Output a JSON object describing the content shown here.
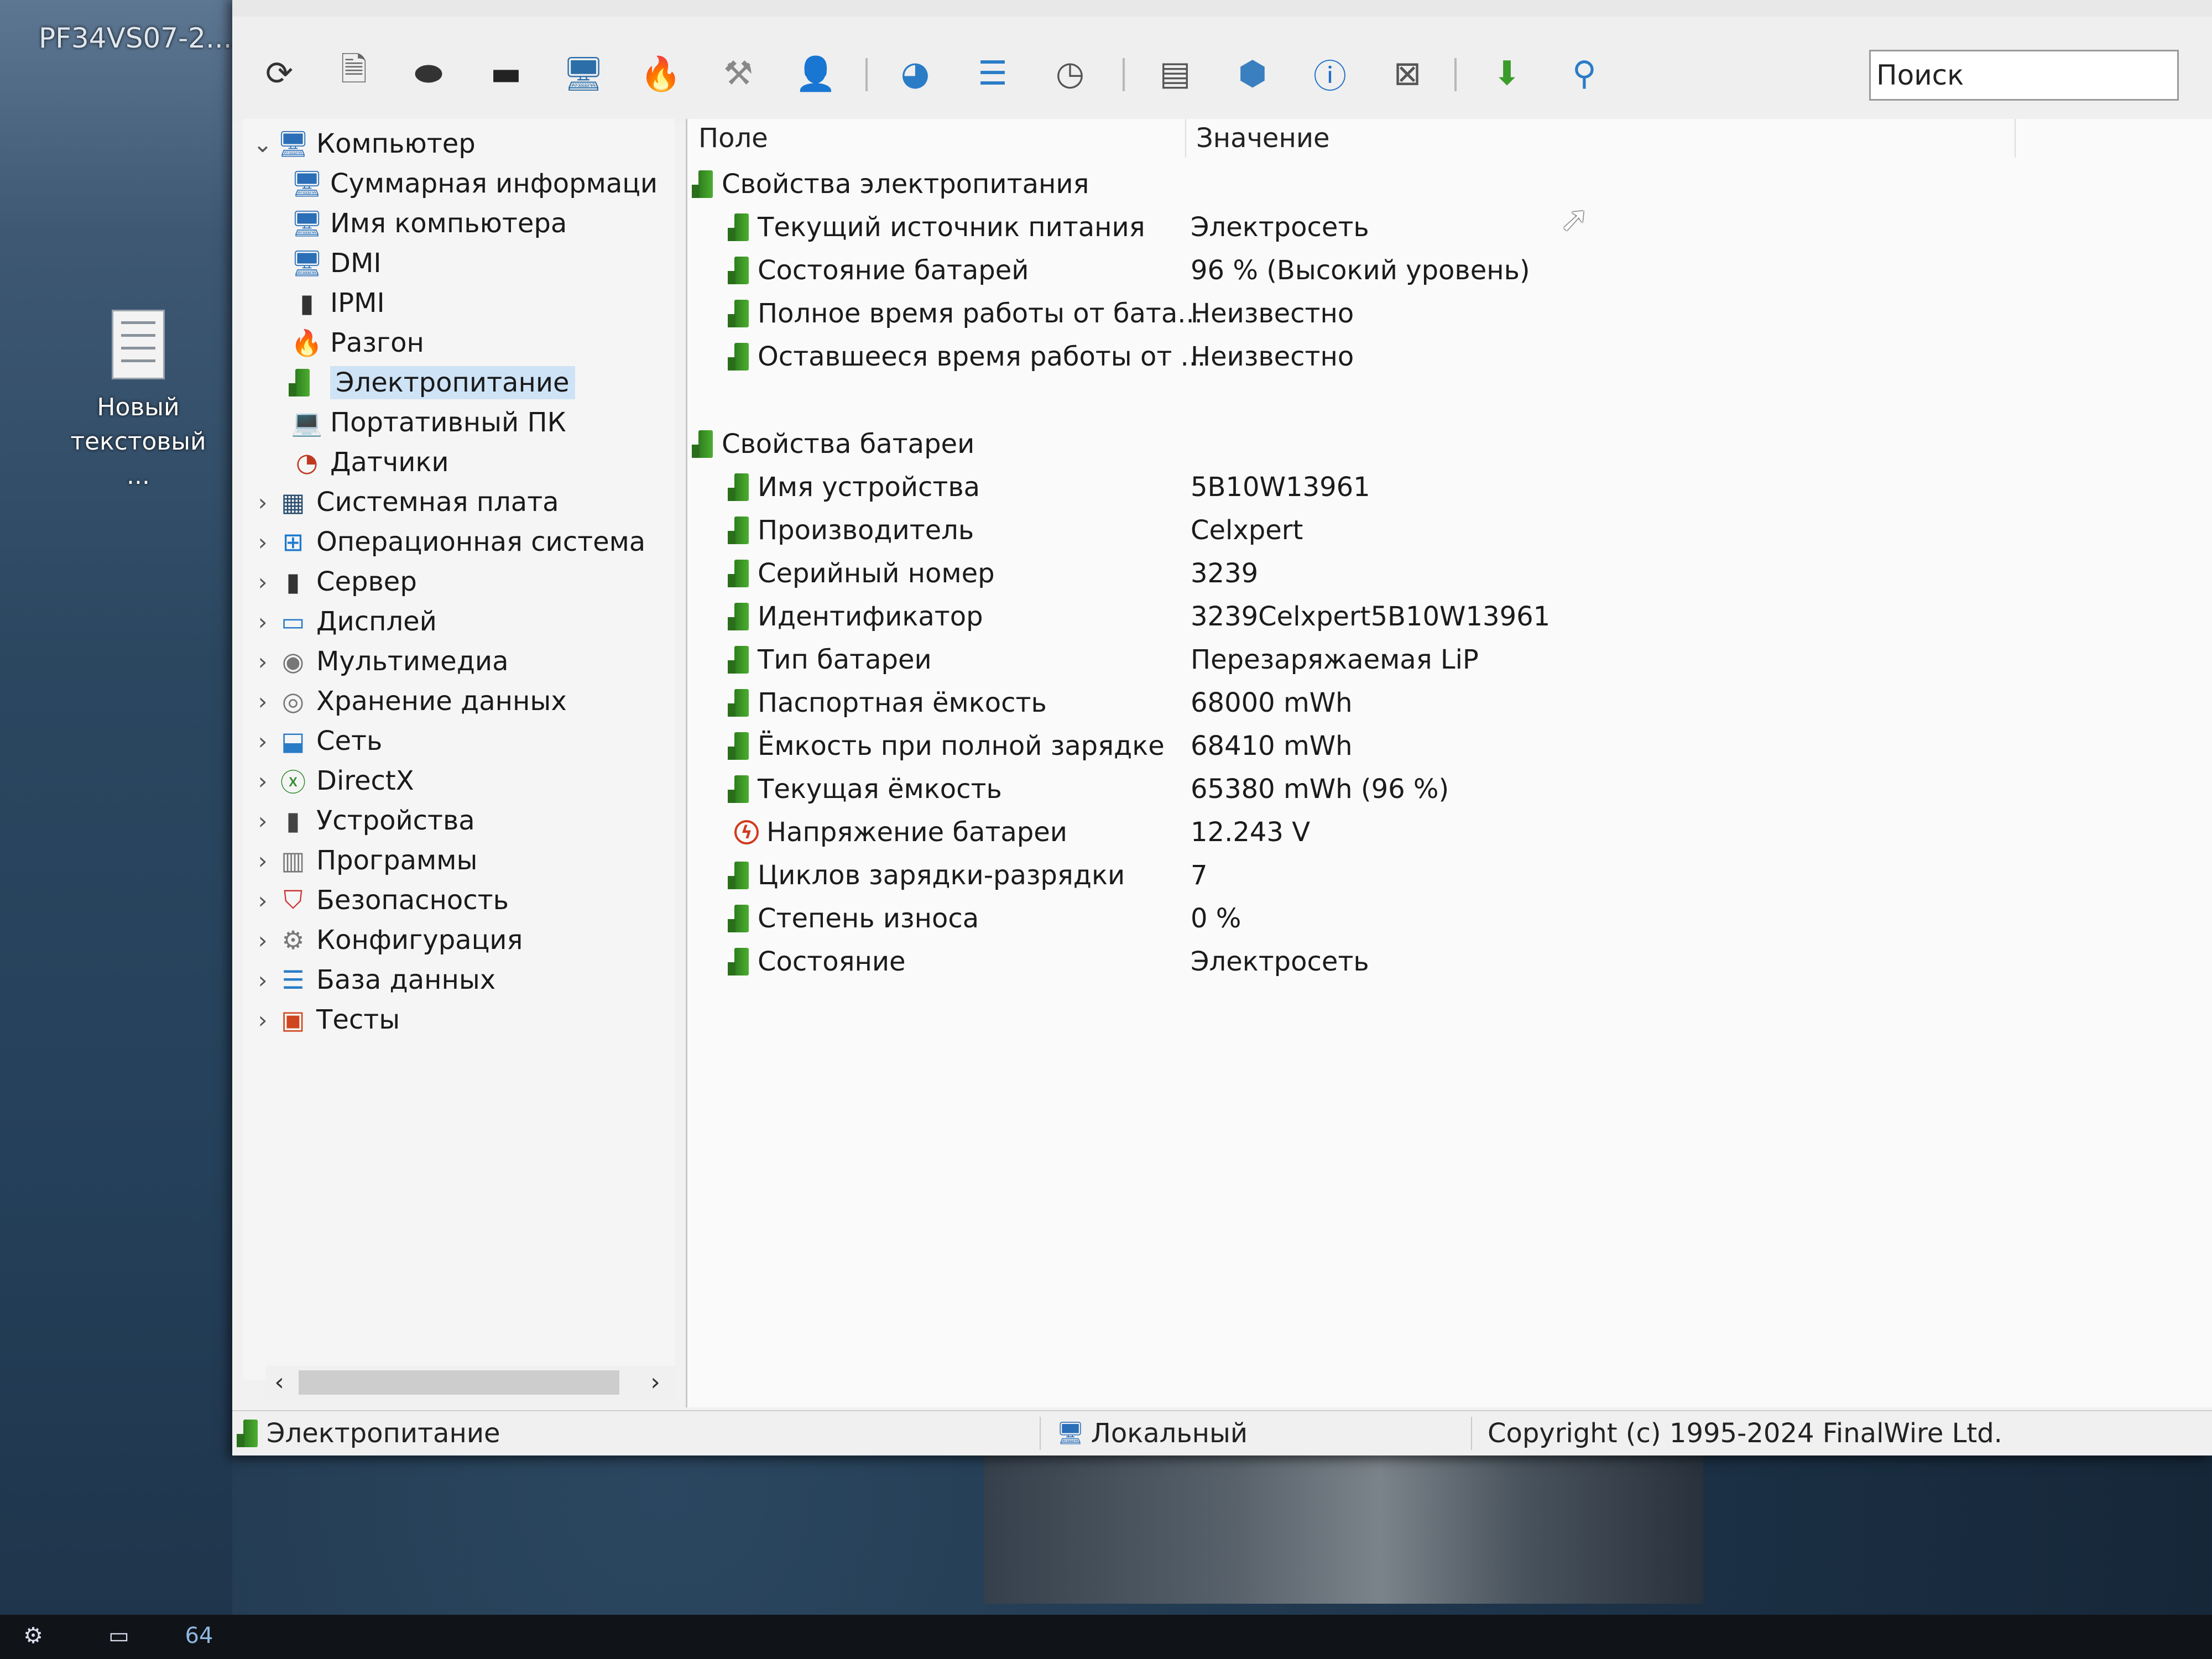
{
  "desktop": {
    "top_label": "PF34VS07-2...",
    "file_icon_label_1": "Новый",
    "file_icon_label_2": "текстовый ..."
  },
  "toolbar": {
    "buttons": [
      "refresh-icon",
      "report-icon",
      "motherboard-icon",
      "memory-icon",
      "computer-icon",
      "flame-icon",
      "tools-icon",
      "user-icon",
      "globe-icon",
      "database-icon",
      "clock-icon",
      "monitor-icon",
      "network-icon",
      "info-icon",
      "pc-icon",
      "download-icon",
      "search-icon"
    ],
    "search_placeholder": "Поиск"
  },
  "tree": {
    "root": "Компьютер",
    "children": [
      "Суммарная информаци",
      "Имя компьютера",
      "DMI",
      "IPMI",
      "Разгон",
      "Электропитание",
      "Портативный ПК",
      "Датчики"
    ],
    "sections": [
      "Системная плата",
      "Операционная система",
      "Сервер",
      "Дисплей",
      "Мультимедиа",
      "Хранение данных",
      "Сеть",
      "DirectX",
      "Устройства",
      "Программы",
      "Безопасность",
      "Конфигурация",
      "База данных",
      "Тесты"
    ]
  },
  "list": {
    "col_field": "Поле",
    "col_value": "Значение",
    "group1": "Свойства электропитания",
    "rows1": [
      {
        "field": "Текущий источник питания",
        "value": "Электросеть"
      },
      {
        "field": "Состояние батарей",
        "value": "96 % (Высокий уровень)"
      },
      {
        "field": "Полное время работы от бата...",
        "value": "Неизвестно"
      },
      {
        "field": "Оставшееся время работы от ...",
        "value": "Неизвестно"
      }
    ],
    "group2": "Свойства батареи",
    "rows2": [
      {
        "field": "Имя устройства",
        "value": "5B10W13961"
      },
      {
        "field": "Производитель",
        "value": "Celxpert"
      },
      {
        "field": "Серийный номер",
        "value": "3239"
      },
      {
        "field": "Идентификатор",
        "value": "3239Celxpert5B10W13961"
      },
      {
        "field": "Тип батареи",
        "value": "Перезаряжаемая LiP"
      },
      {
        "field": "Паспортная ёмкость",
        "value": "68000 mWh"
      },
      {
        "field": "Ёмкость при полной зарядке",
        "value": "68410 mWh"
      },
      {
        "field": "Текущая ёмкость",
        "value": "65380 mWh  (96 %)"
      },
      {
        "field": "Напряжение батареи",
        "value": "12.243 V"
      },
      {
        "field": "Циклов зарядки-разрядки",
        "value": "7"
      },
      {
        "field": "Степень износа",
        "value": "0 %"
      },
      {
        "field": "Состояние",
        "value": "Электросеть"
      }
    ]
  },
  "statusbar": {
    "current": "Электропитание",
    "mode": "Локальный",
    "copyright": "Copyright (c) 1995-2024 FinalWire Ltd."
  },
  "taskbar": {
    "app_badge": "64"
  }
}
